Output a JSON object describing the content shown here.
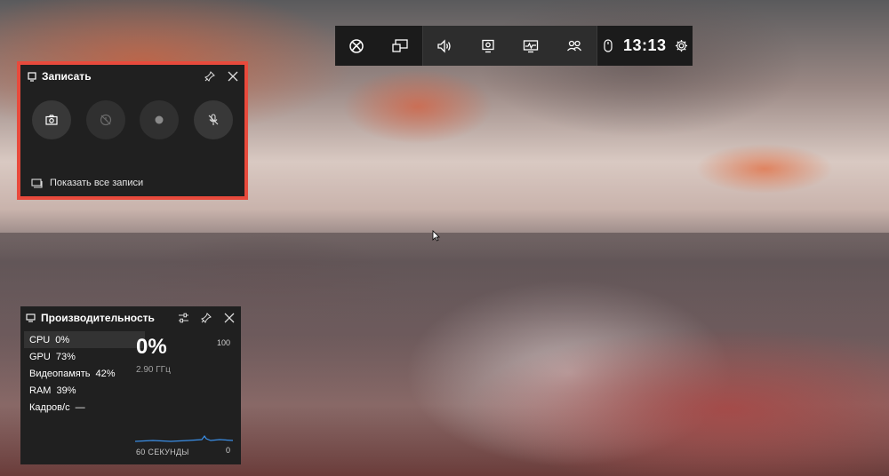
{
  "gamebar": {
    "time": "13:13",
    "buttons": [
      "xbox-icon",
      "widget-menu-icon",
      "audio-icon",
      "capture-icon",
      "performance-icon",
      "social-icon"
    ]
  },
  "capture_widget": {
    "title": "Записать",
    "footer_label": "Показать все записи"
  },
  "performance_widget": {
    "title": "Производительность",
    "stats": [
      {
        "name": "CPU",
        "value": "0%"
      },
      {
        "name": "GPU",
        "value": "73%"
      },
      {
        "name": "Видеопамять",
        "value": "42%"
      },
      {
        "name": "RAM",
        "value": "39%"
      },
      {
        "name": "Кадров/с",
        "value": "—"
      }
    ],
    "big_value": "0%",
    "frequency": "2.90 ГГц",
    "graph_max": "100",
    "graph_min": "0",
    "graph_duration": "60 СЕКУНДЫ"
  },
  "colors": {
    "accent_outline": "#e84a3c",
    "panel_bg": "#202020",
    "graph_line": "#3a8ee6"
  }
}
